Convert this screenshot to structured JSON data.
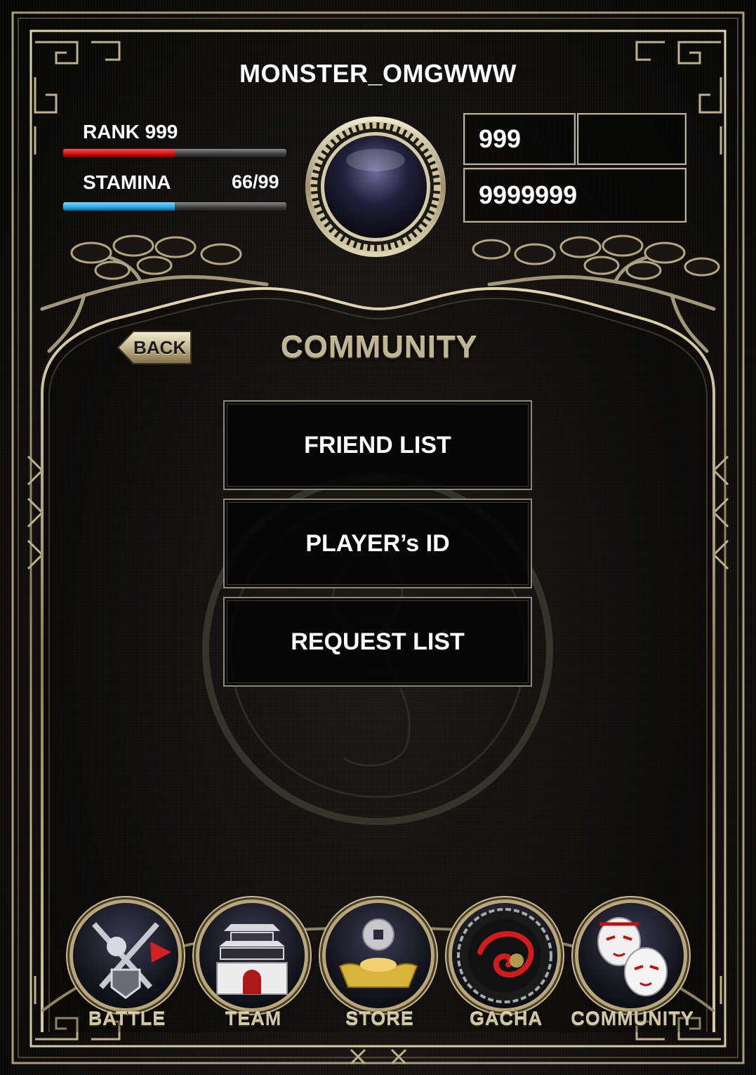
{
  "header": {
    "username": "MONSTER_OMGWWW",
    "rank_label": "RANK 999",
    "stamina_label": "STAMINA",
    "stamina_value": "66/99",
    "rank_progress": 0.5,
    "stamina_progress": 0.5,
    "currency_primary": "999",
    "currency_secondary": "",
    "currency_gold": "9999999"
  },
  "screen": {
    "back_label": "BACK",
    "title": "COMMUNITY"
  },
  "menu": {
    "friend_list": "FRIEND LIST",
    "players_id": "PLAYER’s ID",
    "request_list": "REQUEST LIST"
  },
  "nav": {
    "battle": "BATTLE",
    "team": "TEAM",
    "store": "STORE",
    "gacha": "GACHA",
    "community": "COMMUNITY"
  },
  "colors": {
    "rank_bar": "#d01010",
    "stamina_bar": "#2aa7e8",
    "frame_gold": "#b8a77a"
  }
}
